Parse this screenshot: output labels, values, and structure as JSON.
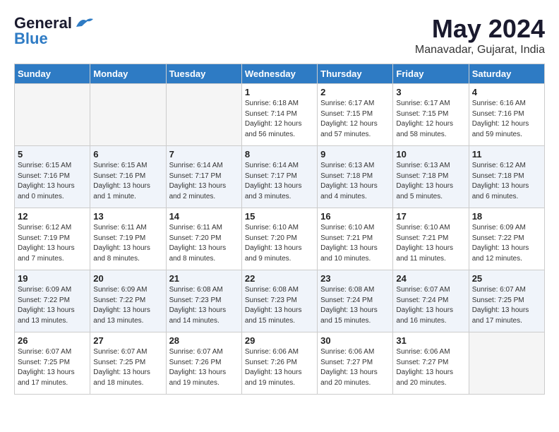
{
  "header": {
    "logo_line1": "General",
    "logo_line2": "Blue",
    "month": "May 2024",
    "location": "Manavadar, Gujarat, India"
  },
  "weekdays": [
    "Sunday",
    "Monday",
    "Tuesday",
    "Wednesday",
    "Thursday",
    "Friday",
    "Saturday"
  ],
  "weeks": [
    [
      {
        "day": "",
        "sunrise": "",
        "sunset": "",
        "daylight": "",
        "empty": true
      },
      {
        "day": "",
        "sunrise": "",
        "sunset": "",
        "daylight": "",
        "empty": true
      },
      {
        "day": "",
        "sunrise": "",
        "sunset": "",
        "daylight": "",
        "empty": true
      },
      {
        "day": "1",
        "sunrise": "Sunrise: 6:18 AM",
        "sunset": "Sunset: 7:14 PM",
        "daylight": "Daylight: 12 hours and 56 minutes.",
        "empty": false
      },
      {
        "day": "2",
        "sunrise": "Sunrise: 6:17 AM",
        "sunset": "Sunset: 7:15 PM",
        "daylight": "Daylight: 12 hours and 57 minutes.",
        "empty": false
      },
      {
        "day": "3",
        "sunrise": "Sunrise: 6:17 AM",
        "sunset": "Sunset: 7:15 PM",
        "daylight": "Daylight: 12 hours and 58 minutes.",
        "empty": false
      },
      {
        "day": "4",
        "sunrise": "Sunrise: 6:16 AM",
        "sunset": "Sunset: 7:16 PM",
        "daylight": "Daylight: 12 hours and 59 minutes.",
        "empty": false
      }
    ],
    [
      {
        "day": "5",
        "sunrise": "Sunrise: 6:15 AM",
        "sunset": "Sunset: 7:16 PM",
        "daylight": "Daylight: 13 hours and 0 minutes.",
        "empty": false
      },
      {
        "day": "6",
        "sunrise": "Sunrise: 6:15 AM",
        "sunset": "Sunset: 7:16 PM",
        "daylight": "Daylight: 13 hours and 1 minute.",
        "empty": false
      },
      {
        "day": "7",
        "sunrise": "Sunrise: 6:14 AM",
        "sunset": "Sunset: 7:17 PM",
        "daylight": "Daylight: 13 hours and 2 minutes.",
        "empty": false
      },
      {
        "day": "8",
        "sunrise": "Sunrise: 6:14 AM",
        "sunset": "Sunset: 7:17 PM",
        "daylight": "Daylight: 13 hours and 3 minutes.",
        "empty": false
      },
      {
        "day": "9",
        "sunrise": "Sunrise: 6:13 AM",
        "sunset": "Sunset: 7:18 PM",
        "daylight": "Daylight: 13 hours and 4 minutes.",
        "empty": false
      },
      {
        "day": "10",
        "sunrise": "Sunrise: 6:13 AM",
        "sunset": "Sunset: 7:18 PM",
        "daylight": "Daylight: 13 hours and 5 minutes.",
        "empty": false
      },
      {
        "day": "11",
        "sunrise": "Sunrise: 6:12 AM",
        "sunset": "Sunset: 7:18 PM",
        "daylight": "Daylight: 13 hours and 6 minutes.",
        "empty": false
      }
    ],
    [
      {
        "day": "12",
        "sunrise": "Sunrise: 6:12 AM",
        "sunset": "Sunset: 7:19 PM",
        "daylight": "Daylight: 13 hours and 7 minutes.",
        "empty": false
      },
      {
        "day": "13",
        "sunrise": "Sunrise: 6:11 AM",
        "sunset": "Sunset: 7:19 PM",
        "daylight": "Daylight: 13 hours and 8 minutes.",
        "empty": false
      },
      {
        "day": "14",
        "sunrise": "Sunrise: 6:11 AM",
        "sunset": "Sunset: 7:20 PM",
        "daylight": "Daylight: 13 hours and 8 minutes.",
        "empty": false
      },
      {
        "day": "15",
        "sunrise": "Sunrise: 6:10 AM",
        "sunset": "Sunset: 7:20 PM",
        "daylight": "Daylight: 13 hours and 9 minutes.",
        "empty": false
      },
      {
        "day": "16",
        "sunrise": "Sunrise: 6:10 AM",
        "sunset": "Sunset: 7:21 PM",
        "daylight": "Daylight: 13 hours and 10 minutes.",
        "empty": false
      },
      {
        "day": "17",
        "sunrise": "Sunrise: 6:10 AM",
        "sunset": "Sunset: 7:21 PM",
        "daylight": "Daylight: 13 hours and 11 minutes.",
        "empty": false
      },
      {
        "day": "18",
        "sunrise": "Sunrise: 6:09 AM",
        "sunset": "Sunset: 7:22 PM",
        "daylight": "Daylight: 13 hours and 12 minutes.",
        "empty": false
      }
    ],
    [
      {
        "day": "19",
        "sunrise": "Sunrise: 6:09 AM",
        "sunset": "Sunset: 7:22 PM",
        "daylight": "Daylight: 13 hours and 13 minutes.",
        "empty": false
      },
      {
        "day": "20",
        "sunrise": "Sunrise: 6:09 AM",
        "sunset": "Sunset: 7:22 PM",
        "daylight": "Daylight: 13 hours and 13 minutes.",
        "empty": false
      },
      {
        "day": "21",
        "sunrise": "Sunrise: 6:08 AM",
        "sunset": "Sunset: 7:23 PM",
        "daylight": "Daylight: 13 hours and 14 minutes.",
        "empty": false
      },
      {
        "day": "22",
        "sunrise": "Sunrise: 6:08 AM",
        "sunset": "Sunset: 7:23 PM",
        "daylight": "Daylight: 13 hours and 15 minutes.",
        "empty": false
      },
      {
        "day": "23",
        "sunrise": "Sunrise: 6:08 AM",
        "sunset": "Sunset: 7:24 PM",
        "daylight": "Daylight: 13 hours and 15 minutes.",
        "empty": false
      },
      {
        "day": "24",
        "sunrise": "Sunrise: 6:07 AM",
        "sunset": "Sunset: 7:24 PM",
        "daylight": "Daylight: 13 hours and 16 minutes.",
        "empty": false
      },
      {
        "day": "25",
        "sunrise": "Sunrise: 6:07 AM",
        "sunset": "Sunset: 7:25 PM",
        "daylight": "Daylight: 13 hours and 17 minutes.",
        "empty": false
      }
    ],
    [
      {
        "day": "26",
        "sunrise": "Sunrise: 6:07 AM",
        "sunset": "Sunset: 7:25 PM",
        "daylight": "Daylight: 13 hours and 17 minutes.",
        "empty": false
      },
      {
        "day": "27",
        "sunrise": "Sunrise: 6:07 AM",
        "sunset": "Sunset: 7:25 PM",
        "daylight": "Daylight: 13 hours and 18 minutes.",
        "empty": false
      },
      {
        "day": "28",
        "sunrise": "Sunrise: 6:07 AM",
        "sunset": "Sunset: 7:26 PM",
        "daylight": "Daylight: 13 hours and 19 minutes.",
        "empty": false
      },
      {
        "day": "29",
        "sunrise": "Sunrise: 6:06 AM",
        "sunset": "Sunset: 7:26 PM",
        "daylight": "Daylight: 13 hours and 19 minutes.",
        "empty": false
      },
      {
        "day": "30",
        "sunrise": "Sunrise: 6:06 AM",
        "sunset": "Sunset: 7:27 PM",
        "daylight": "Daylight: 13 hours and 20 minutes.",
        "empty": false
      },
      {
        "day": "31",
        "sunrise": "Sunrise: 6:06 AM",
        "sunset": "Sunset: 7:27 PM",
        "daylight": "Daylight: 13 hours and 20 minutes.",
        "empty": false
      },
      {
        "day": "",
        "sunrise": "",
        "sunset": "",
        "daylight": "",
        "empty": true
      }
    ]
  ]
}
